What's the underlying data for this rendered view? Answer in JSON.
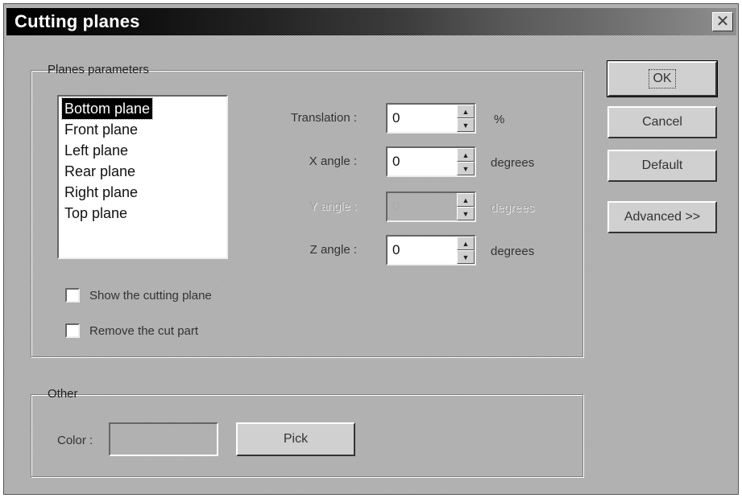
{
  "window": {
    "title": "Cutting planes",
    "close_glyph": "✕"
  },
  "planes_group": {
    "label": "Planes parameters",
    "list": {
      "items": [
        "Bottom plane",
        "Front plane",
        "Left plane",
        "Rear plane",
        "Right plane",
        "Top plane"
      ],
      "selected_index": 0
    },
    "fields": [
      {
        "label": "Translation :",
        "value": "0",
        "unit": "%",
        "enabled": true
      },
      {
        "label": "X angle :",
        "value": "0",
        "unit": "degrees",
        "enabled": true
      },
      {
        "label": "Y angle :",
        "value": "0",
        "unit": "degrees",
        "enabled": false
      },
      {
        "label": "Z angle :",
        "value": "0",
        "unit": "degrees",
        "enabled": true
      }
    ],
    "checkboxes": [
      {
        "label": "Show the cutting plane",
        "checked": false
      },
      {
        "label": "Remove the cut part",
        "checked": false
      }
    ]
  },
  "other_group": {
    "label": "Other",
    "color_label": "Color :",
    "pick_label": "Pick"
  },
  "buttons": {
    "ok": "OK",
    "cancel": "Cancel",
    "default": "Default",
    "advanced": "Advanced >>"
  },
  "icons": {
    "close": "close-icon",
    "spin_up": "spin-up-icon",
    "spin_down": "spin-down-icon"
  }
}
